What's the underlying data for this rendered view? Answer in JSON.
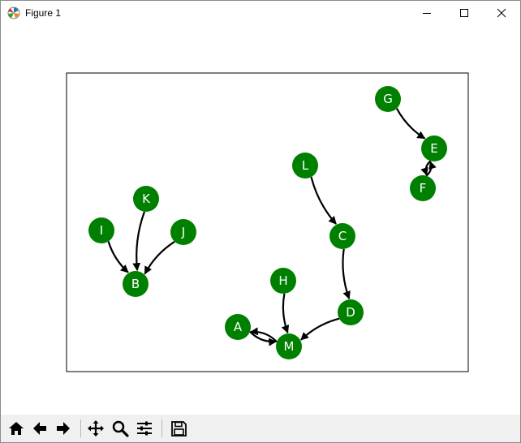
{
  "window": {
    "title": "Figure 1"
  },
  "graph": {
    "node_color": "#008000",
    "edge_color": "#000000",
    "label_color": "#ffffff",
    "nodes": [
      {
        "id": "G",
        "label": "G"
      },
      {
        "id": "E",
        "label": "E"
      },
      {
        "id": "F",
        "label": "F"
      },
      {
        "id": "L",
        "label": "L"
      },
      {
        "id": "C",
        "label": "C"
      },
      {
        "id": "K",
        "label": "K"
      },
      {
        "id": "I",
        "label": "I"
      },
      {
        "id": "J",
        "label": "J"
      },
      {
        "id": "B",
        "label": "B"
      },
      {
        "id": "H",
        "label": "H"
      },
      {
        "id": "D",
        "label": "D"
      },
      {
        "id": "A",
        "label": "A"
      },
      {
        "id": "M",
        "label": "M"
      }
    ],
    "edges": [
      {
        "from": "G",
        "to": "E"
      },
      {
        "from": "F",
        "to": "E"
      },
      {
        "from": "E",
        "to": "F"
      },
      {
        "from": "L",
        "to": "C"
      },
      {
        "from": "C",
        "to": "D"
      },
      {
        "from": "D",
        "to": "M"
      },
      {
        "from": "H",
        "to": "M"
      },
      {
        "from": "A",
        "to": "M"
      },
      {
        "from": "M",
        "to": "A"
      },
      {
        "from": "K",
        "to": "B"
      },
      {
        "from": "I",
        "to": "B"
      },
      {
        "from": "J",
        "to": "B"
      }
    ]
  },
  "toolbar": {
    "buttons": [
      {
        "name": "home-icon"
      },
      {
        "name": "back-icon"
      },
      {
        "name": "forward-icon"
      },
      {
        "name": "pan-icon"
      },
      {
        "name": "zoom-icon"
      },
      {
        "name": "configure-subplots-icon"
      },
      {
        "name": "save-icon"
      }
    ]
  }
}
